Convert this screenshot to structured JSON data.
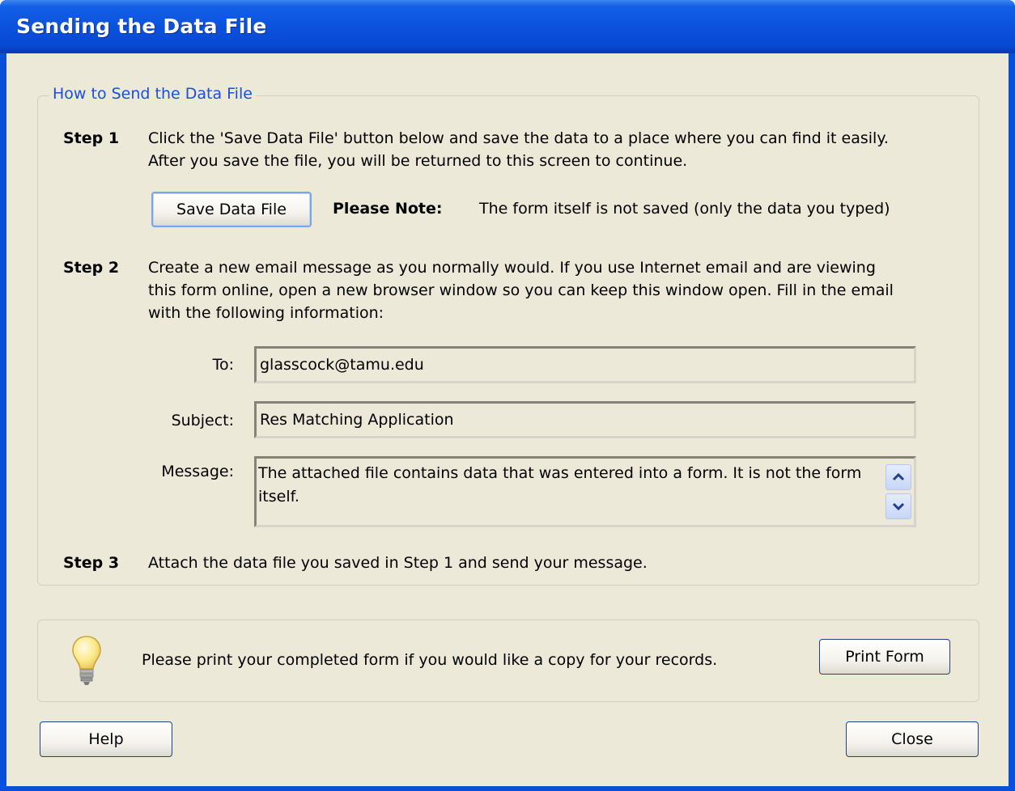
{
  "window": {
    "title": "Sending the Data File"
  },
  "group": {
    "title": "How to Send the Data File"
  },
  "step1": {
    "label": "Step 1",
    "text": "Click the 'Save Data File' button below and save the data to a place where you can find it easily. After you save the file, you will be returned to this screen to continue.",
    "save_button": "Save Data File",
    "note_label": "Please Note:",
    "note_text": "The form itself is not saved (only the data you typed)"
  },
  "step2": {
    "label": "Step 2",
    "text": "Create a new email message as you normally would.  If you use Internet email and are viewing this form online, open a new browser window so you can keep this window open. Fill in the email with the following information:",
    "to_label": "To:",
    "to_value": "glasscock@tamu.edu",
    "subject_label": "Subject:",
    "subject_value": "Res Matching Application",
    "message_label": "Message:",
    "message_value": "The attached file contains data that was entered into a form. It is not the form itself."
  },
  "step3": {
    "label": "Step 3",
    "text": "Attach the data file you saved in Step 1 and send your message."
  },
  "tip": {
    "icon": "lightbulb-icon",
    "text": "Please print your completed form if you would like a copy for your records.",
    "print_button": "Print Form"
  },
  "footer": {
    "help_button": "Help",
    "close_button": "Close"
  },
  "colors": {
    "titlebar": "#0a52de",
    "client_bg": "#ece9d8",
    "group_title": "#1a4fd8"
  }
}
